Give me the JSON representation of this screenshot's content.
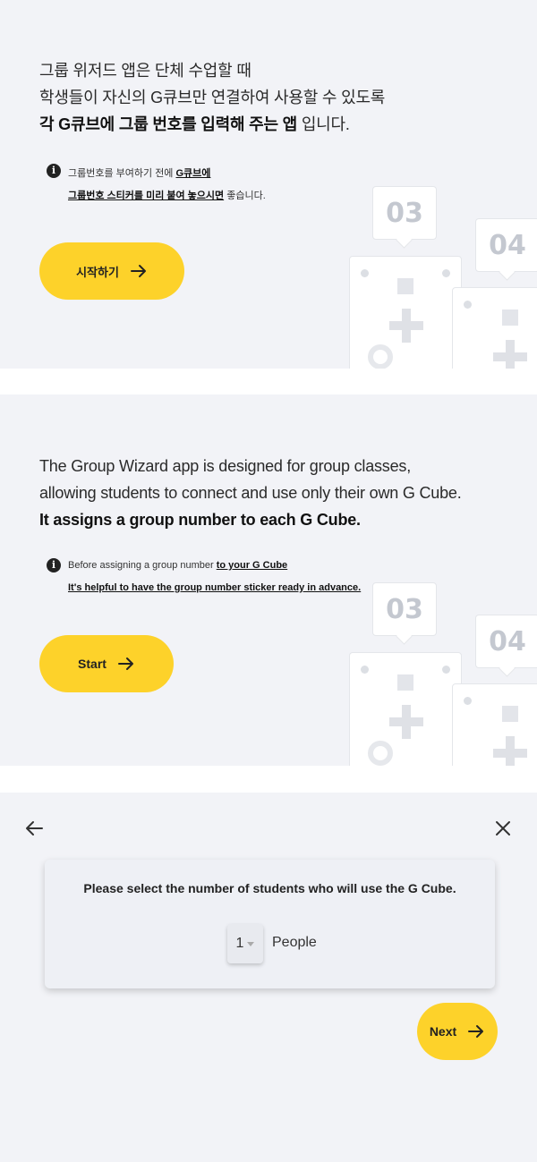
{
  "panel_ko": {
    "intro_line1": "그룹 위저드 앱은 단체 수업할 때",
    "intro_line2": "학생들이 자신의 G큐브만 연결하여 사용할 수 있도록",
    "intro_line3_bold": "각 G큐브에 그룹 번호를 입력해 주는 앱",
    "intro_line3_rest": " 입니다.",
    "notice_line1_plain": "그룹번호를 부여하기 전에 ",
    "notice_line1_link": "G큐브에",
    "notice_line2_link": "그룹번호 스티커를 미리 붙여 놓으시면",
    "notice_line2_rest": " 좋습니다.",
    "start_label": "시작하기",
    "tag_a": "03",
    "tag_b": "04"
  },
  "panel_en": {
    "intro_line1": "The Group Wizard app is designed for group classes,",
    "intro_line2": "allowing students to connect and use only their own G Cube.",
    "intro_line3_bold": "It assigns a group number to each G Cube.",
    "notice_line1_plain": "Before assigning a group number ",
    "notice_line1_link": "to your G Cube",
    "notice_line2_link": "It's helpful to have the group number sticker ready in advance.",
    "start_label": "Start",
    "tag_a": "03",
    "tag_b": "04"
  },
  "panel_select": {
    "card_title": "Please select the number of students who will use the G Cube.",
    "selected_count": "1",
    "unit_label": "People",
    "next_label": "Next"
  },
  "icons": {
    "info": "info-icon",
    "arrow_right": "arrow-right-icon",
    "back": "arrow-left-icon",
    "close": "close-icon"
  },
  "colors": {
    "accent": "#fdd22a",
    "panel_bg": "#f2f3f7"
  }
}
